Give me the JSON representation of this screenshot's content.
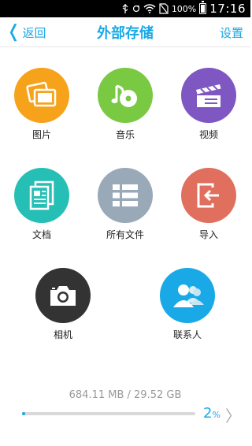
{
  "status_bar": {
    "battery_percent": "100%",
    "time": "17:16",
    "icons": [
      "usb-icon",
      "sync-icon",
      "wifi-icon",
      "no-sim-icon",
      "battery-icon"
    ]
  },
  "header": {
    "back_label": "返回",
    "title": "外部存储",
    "settings_label": "设置"
  },
  "categories": [
    {
      "label": "图片",
      "icon": "image-icon",
      "color": "#f7a21b"
    },
    {
      "label": "音乐",
      "icon": "music-icon",
      "color": "#7ac943"
    },
    {
      "label": "视频",
      "icon": "video-icon",
      "color": "#7e57c2"
    },
    {
      "label": "文档",
      "icon": "document-icon",
      "color": "#26bfb5"
    },
    {
      "label": "所有文件",
      "icon": "all-files-icon",
      "color": "#9aa9b8"
    },
    {
      "label": "导入",
      "icon": "import-icon",
      "color": "#e06f5e"
    },
    {
      "label": "相机",
      "icon": "camera-icon",
      "color": "#333333"
    },
    {
      "label": "联系人",
      "icon": "contacts-icon",
      "color": "#19a9e6"
    }
  ],
  "storage": {
    "usage_text": "684.11 MB / 29.52 GB",
    "percent_value": "2",
    "percent_sign": "%",
    "used_fraction": 0.02
  },
  "colors": {
    "accent": "#19a9e6"
  }
}
